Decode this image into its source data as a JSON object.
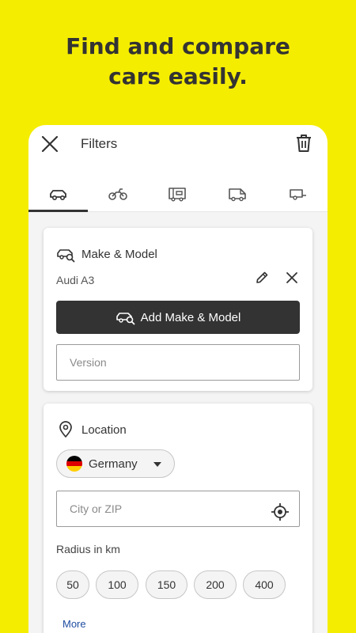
{
  "headline": {
    "line1": "Find and compare",
    "line2": "cars easily."
  },
  "topbar": {
    "title": "Filters"
  },
  "tabs": [
    {
      "name": "car",
      "active": true
    },
    {
      "name": "motorbike",
      "active": false
    },
    {
      "name": "motorhome",
      "active": false
    },
    {
      "name": "van",
      "active": false
    },
    {
      "name": "trailer",
      "active": false
    }
  ],
  "make_model": {
    "title": "Make & Model",
    "selected": "Audi A3",
    "add_label": "Add Make & Model",
    "version_placeholder": "Version"
  },
  "location": {
    "title": "Location",
    "country": "Germany",
    "city_placeholder": "City or ZIP",
    "radius_label": "Radius in km",
    "radius_options": [
      "50",
      "100",
      "150",
      "200",
      "400"
    ],
    "more_label": "More"
  },
  "colors": {
    "background": "#f5ed00",
    "dark": "#333333",
    "link": "#1e4da0"
  }
}
